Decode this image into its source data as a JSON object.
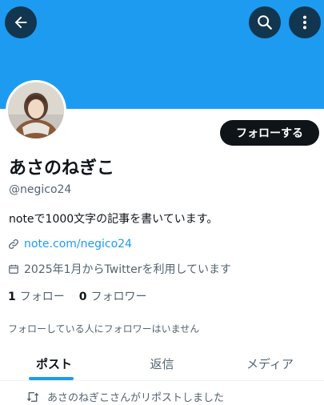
{
  "colors": {
    "banner": "#1d9bf0",
    "accent": "#1d9bf0",
    "text_primary": "#0f1419",
    "text_secondary": "#536471",
    "button_dark": "#0f1419"
  },
  "header": {
    "back_icon": "arrow-left-icon",
    "search_icon": "search-icon",
    "more_icon": "vertical-ellipsis-icon"
  },
  "profile": {
    "follow_label": "フォローする",
    "display_name": "あさのねぎこ",
    "handle": "@negico24",
    "bio": "noteで1000文字の記事を書いています。",
    "link": "note.com/negico24",
    "joined": "2025年1月からTwitterを利用しています",
    "following_count": "1",
    "following_label": "フォロー",
    "followers_count": "0",
    "followers_label": "フォロワー",
    "mutual_note": "フォローしている人にフォロワーはいません"
  },
  "tabs": [
    {
      "label": "ポスト"
    },
    {
      "label": "返信"
    },
    {
      "label": "メディア"
    }
  ],
  "feed": {
    "repost_notice": "あさのねぎこさんがリポストしました"
  }
}
